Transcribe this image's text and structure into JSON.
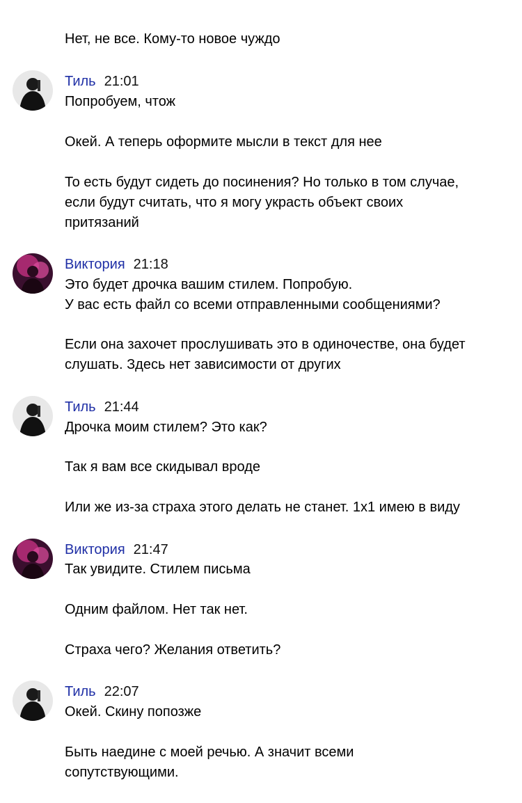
{
  "messages": [
    {
      "author": "",
      "time": "",
      "lines": [
        "Нет, не все. Кому-то новое чуждо"
      ]
    },
    {
      "author": "Тиль",
      "time": "21:01",
      "avatar_icon": "dark-figure-avatar-icon",
      "lines": [
        "Попробуем, чтож",
        "Окей. А теперь оформите мысли в текст для нее",
        "То есть будут сидеть до посинения? Но только в том случае,",
        "если будут считать, что я могу украсть объект своих",
        "притязаний"
      ]
    },
    {
      "author": "Виктория",
      "time": "21:18",
      "avatar_icon": "pink-portrait-avatar-icon",
      "lines": [
        "Это будет дрочка вашим стилем. Попробую.",
        "У вас есть файл со всеми отправленными сообщениями?",
        "Если она захочет прослушивать это в одиночестве, она будет",
        "слушать. Здесь нет зависимости от других"
      ]
    },
    {
      "author": "Тиль",
      "time": "21:44",
      "avatar_icon": "dark-figure-avatar-icon",
      "lines": [
        "Дрочка моим стилем? Это как?",
        "Так я вам все скидывал вроде",
        "Или же из-за страха этого делать не станет. 1x1 имею в виду"
      ]
    },
    {
      "author": "Виктория",
      "time": "21:47",
      "avatar_icon": "pink-portrait-avatar-icon",
      "lines": [
        "Так увидите. Стилем письма",
        "Одним файлом. Нет так нет.",
        "Страха чего? Желания ответить?"
      ]
    },
    {
      "author": "Тиль",
      "time": "22:07",
      "avatar_icon": "dark-figure-avatar-icon",
      "lines": [
        "Окей. Скину попозже",
        "Быть наедине с моей речью. А значит всеми",
        "сопутствующими."
      ]
    }
  ],
  "colors": {
    "author_link": "#1f2fa6",
    "text": "#000000",
    "background": "#ffffff"
  }
}
